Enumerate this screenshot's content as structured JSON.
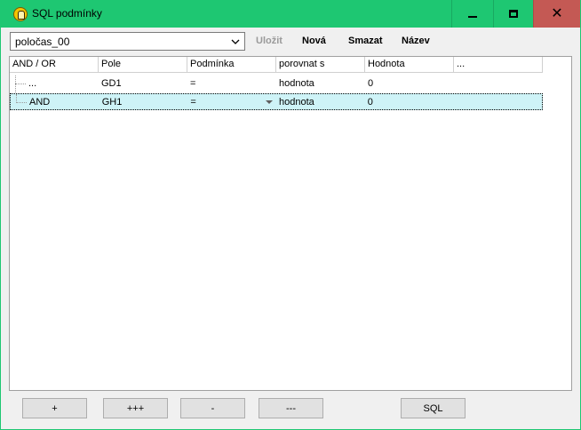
{
  "window": {
    "title": "SQL podmínky",
    "icon": "app-icon",
    "controls": {
      "minimize": "minimize-icon",
      "maximize": "maximize-icon",
      "close": "✕"
    }
  },
  "colors": {
    "titlebar": "#1ec772",
    "close_button": "#c45954",
    "selected_row": "#cef3f7"
  },
  "toolbar": {
    "preset_value": "poločas_00",
    "save_label": "Uložit",
    "new_label": "Nová",
    "delete_label": "Smazat",
    "name_label": "Název"
  },
  "grid": {
    "columns": [
      "AND / OR",
      "Pole",
      "Podmínka",
      "porovnat s",
      "Hodnota",
      "..."
    ],
    "rows": [
      {
        "andor": "...",
        "field": "GD1",
        "condition": "=",
        "compare": "hodnota",
        "value": "0",
        "extra": ""
      },
      {
        "andor": "AND",
        "field": "GH1",
        "condition": "=",
        "compare": "hodnota",
        "value": "0",
        "extra": "",
        "selected": true
      }
    ]
  },
  "buttons": {
    "add": "+",
    "add_group": "+++",
    "remove": "-",
    "remove_group": "---",
    "sql": "SQL"
  }
}
